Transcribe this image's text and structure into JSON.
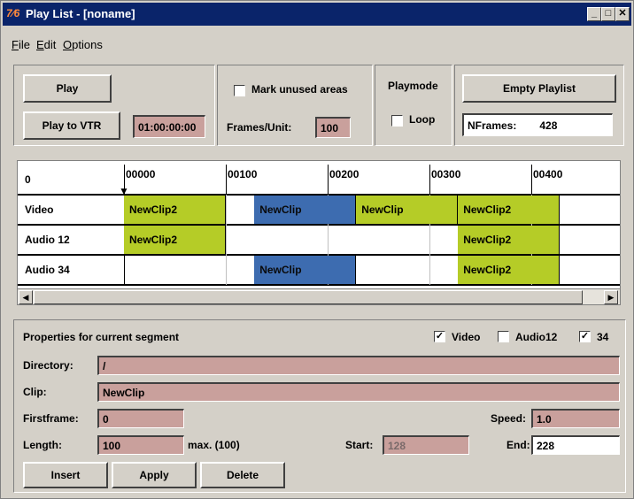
{
  "window": {
    "title": "Play List - [noname]",
    "app_icon_glyph": "7⁄6"
  },
  "menu": [
    {
      "hotkey": "F",
      "rest": "ile"
    },
    {
      "hotkey": "E",
      "rest": "dit"
    },
    {
      "hotkey": "O",
      "rest": "ptions"
    }
  ],
  "controls": {
    "play_label": "Play",
    "play_to_vtr_label": "Play to VTR",
    "vtr_timecode": "01:00:00:00",
    "mark_unused_label": "Mark unused areas",
    "mark_unused_checked": false,
    "frames_unit_label": "Frames/Unit:",
    "frames_unit_value": "100",
    "playmode_label": "Playmode",
    "loop_label": "Loop",
    "loop_checked": false,
    "empty_playlist_label": "Empty Playlist",
    "nframes_label": "NFrames:",
    "nframes_value": "428"
  },
  "timeline": {
    "origin_label": "0",
    "ticks": [
      "00000",
      "00100",
      "00200",
      "00300",
      "00400"
    ],
    "tracks": [
      {
        "name": "Video",
        "clips": [
          {
            "label": "NewClip2",
            "start": 0,
            "end": 100,
            "color": "green"
          },
          {
            "label": "NewClip",
            "start": 128,
            "end": 228,
            "color": "blue"
          },
          {
            "label": "NewClip",
            "start": 228,
            "end": 328,
            "color": "green"
          },
          {
            "label": "NewClip2",
            "start": 328,
            "end": 428,
            "color": "green"
          }
        ]
      },
      {
        "name": "Audio 12",
        "clips": [
          {
            "label": "NewClip2",
            "start": 0,
            "end": 100,
            "color": "green"
          },
          {
            "label": "NewClip2",
            "start": 328,
            "end": 428,
            "color": "green"
          }
        ]
      },
      {
        "name": "Audio 34",
        "clips": [
          {
            "label": "NewClip",
            "start": 128,
            "end": 228,
            "color": "blue"
          },
          {
            "label": "NewClip2",
            "start": 328,
            "end": 428,
            "color": "green"
          }
        ]
      }
    ],
    "colors": {
      "green": "#b5cc27",
      "blue": "#3d6cb0"
    }
  },
  "properties": {
    "heading": "Properties for current segment",
    "video_label": "Video",
    "video_checked": true,
    "audio12_label": "Audio12",
    "audio12_checked": false,
    "a34_label": "34",
    "a34_checked": true,
    "directory_label": "Directory:",
    "directory_value": "/",
    "clip_label": "Clip:",
    "clip_value": "NewClip",
    "firstframe_label": "Firstframe:",
    "firstframe_value": "0",
    "speed_label": "Speed:",
    "speed_value": "1.0",
    "length_label": "Length:",
    "length_value": "100",
    "max_label": "max. (100)",
    "start_label": "Start:",
    "start_value": "128",
    "end_label": "End:",
    "end_value": "228",
    "insert_label": "Insert",
    "apply_label": "Apply",
    "delete_label": "Delete"
  }
}
